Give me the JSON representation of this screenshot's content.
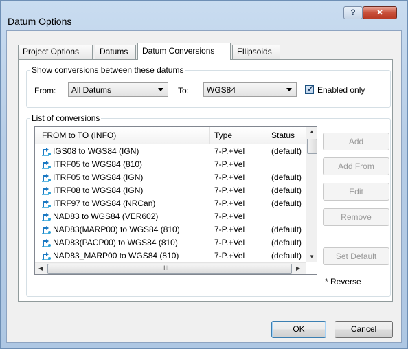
{
  "window": {
    "title": "Datum Options",
    "help_label": "?",
    "close_label": "✕",
    "help_icon": "question-mark-icon",
    "close_icon": "close-icon"
  },
  "tabs": [
    {
      "label": "Project Options",
      "active": false
    },
    {
      "label": "Datums",
      "active": false
    },
    {
      "label": "Datum Conversions",
      "active": true
    },
    {
      "label": "Ellipsoids",
      "active": false
    }
  ],
  "show_conversions": {
    "legend": "Show conversions between these datums",
    "from_label": "From:",
    "from_value": "All Datums",
    "to_label": "To:",
    "to_value": "WGS84",
    "enabled_only_label": "Enabled only",
    "enabled_only_checked": true
  },
  "list_of_conversions": {
    "legend": "List of conversions",
    "columns": [
      "FROM to TO (INFO)",
      "Type",
      "Status"
    ],
    "row_icon": "conversion-arrow-icon",
    "rows": [
      {
        "name": "IGS08 to WGS84 (IGN)",
        "type": "7-P.+Vel",
        "status": "(default)"
      },
      {
        "name": "ITRF05 to WGS84 (810)",
        "type": "7-P.+Vel",
        "status": ""
      },
      {
        "name": "ITRF05 to WGS84 (IGN)",
        "type": "7-P.+Vel",
        "status": "(default)"
      },
      {
        "name": "ITRF08 to WGS84 (IGN)",
        "type": "7-P.+Vel",
        "status": "(default)"
      },
      {
        "name": "ITRF97 to WGS84 (NRCan)",
        "type": "7-P.+Vel",
        "status": "(default)"
      },
      {
        "name": "NAD83 to WGS84 (VER602)",
        "type": "7-P.+Vel",
        "status": ""
      },
      {
        "name": "NAD83(MARP00) to WGS84 (810)",
        "type": "7-P.+Vel",
        "status": "(default)"
      },
      {
        "name": "NAD83(PACP00) to WGS84 (810)",
        "type": "7-P.+Vel",
        "status": "(default)"
      },
      {
        "name": "NAD83_MARP00 to WGS84 (810)",
        "type": "7-P.+Vel",
        "status": "(default)"
      }
    ],
    "scroll_center_label": "III"
  },
  "side_buttons": {
    "add": "Add",
    "add_from": "Add From",
    "edit": "Edit",
    "remove": "Remove",
    "set_default": "Set Default",
    "reverse_note": "* Reverse"
  },
  "footer": {
    "ok": "OK",
    "cancel": "Cancel"
  },
  "colors": {
    "title_bar": "#c9dcf0",
    "close_button": "#c9503a",
    "tab_border": "#919b9c",
    "default_button_border": "#3c7fb1"
  }
}
